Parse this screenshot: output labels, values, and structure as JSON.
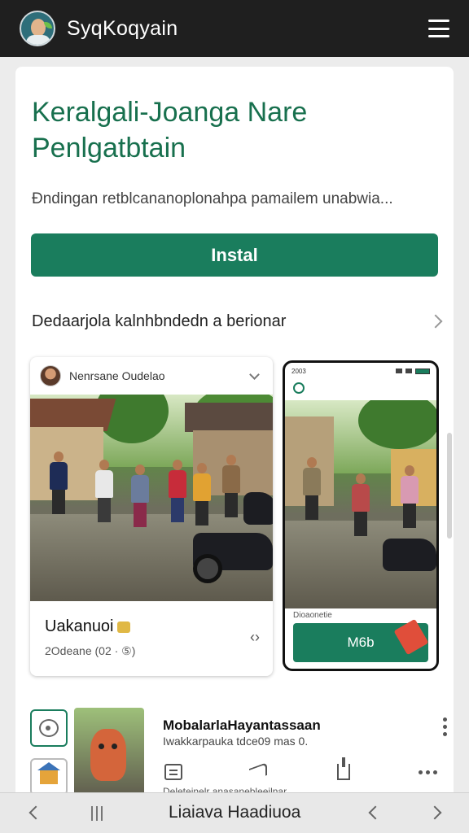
{
  "header": {
    "app_title": "SyqKoqyain",
    "avatar_icon": "user-avatar",
    "menu_icon": "hamburger-menu-icon"
  },
  "card": {
    "title": "Keralgali-Joanga Nare Penlgatbtain",
    "description": "Đndingan retblcananoplonahpa pamailem unabwia...",
    "install_label": "Instal",
    "section_label": "Dedaarjola kalnhbndedn a berionar"
  },
  "post": {
    "author": "Nenrsane Oudelao",
    "title": "Uakanuoi",
    "subtitle": "2Odeane (02 · ⑤)",
    "share_icon": "share-chevron-icon"
  },
  "phone": {
    "status_time": "2003",
    "caption": "Dioaonetie",
    "button_label": "M6b"
  },
  "list_item": {
    "title": "MobalarlaHayantassaan",
    "subtitle": "Iwakkarpauka tdce09 mas 0.",
    "cut_text": "Deleteinelr anasanebleeilnar"
  },
  "bottom_bar": {
    "title": "Liaiava Haadiuoa"
  },
  "colors": {
    "accent": "#1a7d5d",
    "title_green": "#18704e",
    "topbar": "#1f1f1f"
  }
}
